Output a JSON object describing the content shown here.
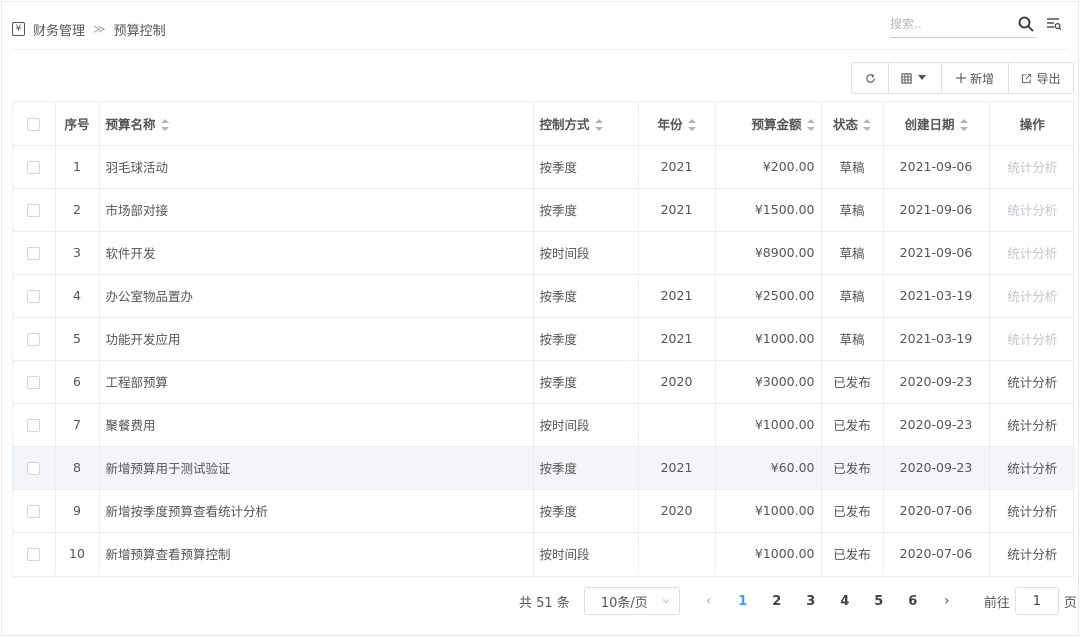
{
  "breadcrumb": {
    "icon": "¥",
    "root": "财务管理",
    "separator": "≫",
    "current": "预算控制"
  },
  "search": {
    "placeholder": "搜索..",
    "value": ""
  },
  "toolbar": {
    "add_label": "新增",
    "export_label": "导出"
  },
  "table": {
    "headers": {
      "index": "序号",
      "name": "预算名称",
      "method": "控制方式",
      "year": "年份",
      "amount": "预算金额",
      "status": "状态",
      "created": "创建日期",
      "action": "操作"
    },
    "rows": [
      {
        "index": "1",
        "name": "羽毛球活动",
        "method": "按季度",
        "year": "2021",
        "amount": "¥200.00",
        "status": "草稿",
        "created": "2021-09-06",
        "action": "统计分析",
        "action_enabled": false
      },
      {
        "index": "2",
        "name": "市场部对接",
        "method": "按季度",
        "year": "2021",
        "amount": "¥1500.00",
        "status": "草稿",
        "created": "2021-09-06",
        "action": "统计分析",
        "action_enabled": false
      },
      {
        "index": "3",
        "name": "软件开发",
        "method": "按时间段",
        "year": "",
        "amount": "¥8900.00",
        "status": "草稿",
        "created": "2021-09-06",
        "action": "统计分析",
        "action_enabled": false
      },
      {
        "index": "4",
        "name": "办公室物品置办",
        "method": "按季度",
        "year": "2021",
        "amount": "¥2500.00",
        "status": "草稿",
        "created": "2021-03-19",
        "action": "统计分析",
        "action_enabled": false
      },
      {
        "index": "5",
        "name": "功能开发应用",
        "method": "按季度",
        "year": "2021",
        "amount": "¥1000.00",
        "status": "草稿",
        "created": "2021-03-19",
        "action": "统计分析",
        "action_enabled": false
      },
      {
        "index": "6",
        "name": "工程部预算",
        "method": "按季度",
        "year": "2020",
        "amount": "¥3000.00",
        "status": "已发布",
        "created": "2020-09-23",
        "action": "统计分析",
        "action_enabled": true
      },
      {
        "index": "7",
        "name": "聚餐费用",
        "method": "按时间段",
        "year": "",
        "amount": "¥1000.00",
        "status": "已发布",
        "created": "2020-09-23",
        "action": "统计分析",
        "action_enabled": true
      },
      {
        "index": "8",
        "name": "新增预算用于测试验证",
        "method": "按季度",
        "year": "2021",
        "amount": "¥60.00",
        "status": "已发布",
        "created": "2020-09-23",
        "action": "统计分析",
        "action_enabled": true
      },
      {
        "index": "9",
        "name": "新增按季度预算查看统计分析",
        "method": "按季度",
        "year": "2020",
        "amount": "¥1000.00",
        "status": "已发布",
        "created": "2020-07-06",
        "action": "统计分析",
        "action_enabled": true
      },
      {
        "index": "10",
        "name": "新增预算查看预算控制",
        "method": "按时间段",
        "year": "",
        "amount": "¥1000.00",
        "status": "已发布",
        "created": "2020-07-06",
        "action": "统计分析",
        "action_enabled": true
      }
    ]
  },
  "pagination": {
    "total": "共 51 条",
    "page_size": "10条/页",
    "pages": [
      "1",
      "2",
      "3",
      "4",
      "5",
      "6"
    ],
    "current_page": "1",
    "goto_prefix": "前往",
    "goto_value": "1",
    "goto_suffix": "页"
  },
  "colors": {
    "accent": "#409eff",
    "border": "#ebeef5",
    "disabled_text": "#c3c6cc",
    "hover_row": "#f3f5f9"
  }
}
